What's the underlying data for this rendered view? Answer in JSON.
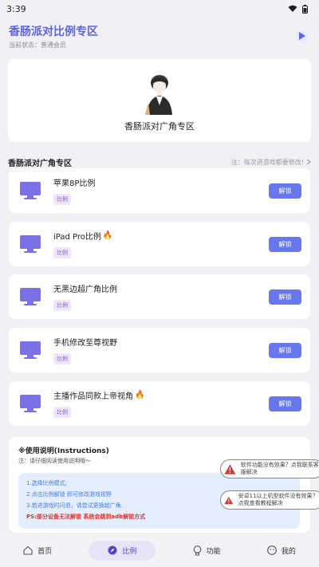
{
  "status": {
    "time": "3:39"
  },
  "header": {
    "title": "香肠派对比例专区",
    "subtitle": "当前状态：普通会员"
  },
  "hero": {
    "caption": "香肠派对广角专区"
  },
  "section": {
    "title": "香肠派对广角专区",
    "note": "注：每次进游戏都要修改!"
  },
  "cards": [
    {
      "name": "苹果8P比例",
      "tag": "比例",
      "button": "解锁",
      "fire": ""
    },
    {
      "name": "iPad Pro比例",
      "tag": "比例",
      "button": "解锁",
      "fire": "🔥"
    },
    {
      "name": "无黑边超广角比例",
      "tag": "比例",
      "button": "解锁",
      "fire": ""
    },
    {
      "name": "手机修改至尊视野",
      "tag": "比例",
      "button": "解锁",
      "fire": ""
    },
    {
      "name": "主播作品同款上帝视角",
      "tag": "比例",
      "button": "解锁",
      "fire": "🔥"
    }
  ],
  "instructions": {
    "title": "※使用说明(Instructions)",
    "note": "注：请仔细阅读使用说明哦～",
    "lines": [
      "1.选择比例模式;",
      "2.点击比例解锁 即可修改游戏视野",
      "3.若进游戏时闪退，请尝试更换超广角.",
      "PS:部分设备无法解锁 系统会跳到adb解锁方式"
    ]
  },
  "toasts": [
    {
      "text": "软件功能没有效果？点我联系客服解决"
    },
    {
      "text": "安卓11以上机型软件没有效果？点我查看教程解决"
    }
  ],
  "nav": [
    {
      "label": "首页",
      "icon": "home-icon"
    },
    {
      "label": "比例",
      "icon": "compass-icon"
    },
    {
      "label": "功能",
      "icon": "bulb-icon"
    },
    {
      "label": "我的",
      "icon": "profile-icon"
    }
  ],
  "colors": {
    "accent": "#6778ee",
    "title": "#5b63e6",
    "tag_bg": "#efe6fb",
    "warning": "#e0342f"
  }
}
